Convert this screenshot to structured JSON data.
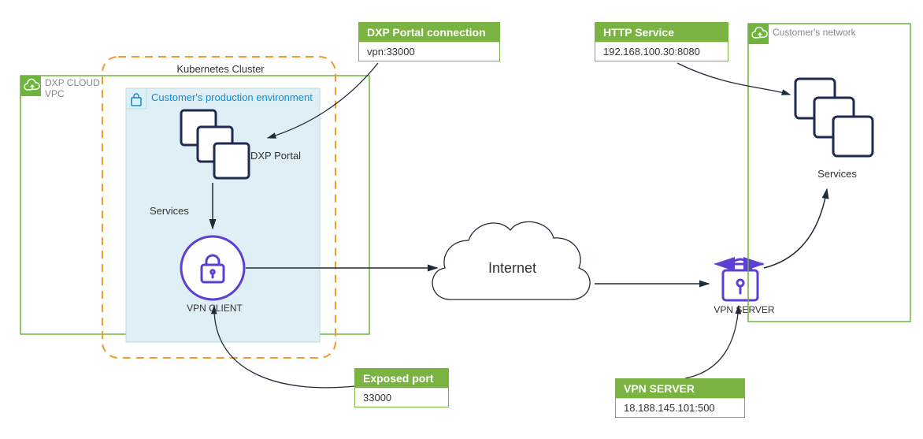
{
  "vpc": {
    "title": "DXP CLOUD\nVPC"
  },
  "k8s": {
    "title": "Kubernetes Cluster"
  },
  "prod_env": {
    "title": "Customer's production environment"
  },
  "dxp_portal": {
    "label": "DXP Portal"
  },
  "services_left": {
    "label": "Services"
  },
  "vpn_client": {
    "label": "VPN CLIENT"
  },
  "internet": {
    "label": "Internet"
  },
  "vpn_server": {
    "label": "VPN SERVER"
  },
  "customer_net": {
    "title": "Customer's network"
  },
  "services_right": {
    "label": "Services"
  },
  "callouts": {
    "portal_conn": {
      "title": "DXP Portal connection",
      "value": "vpn:33000"
    },
    "exposed_port": {
      "title": "Exposed port",
      "value": "33000"
    },
    "http_service": {
      "title": "HTTP Service",
      "value": "192.168.100.30:8080"
    },
    "vpn_server_addr": {
      "title": "VPN SERVER",
      "value": "18.188.145.101:500"
    }
  }
}
